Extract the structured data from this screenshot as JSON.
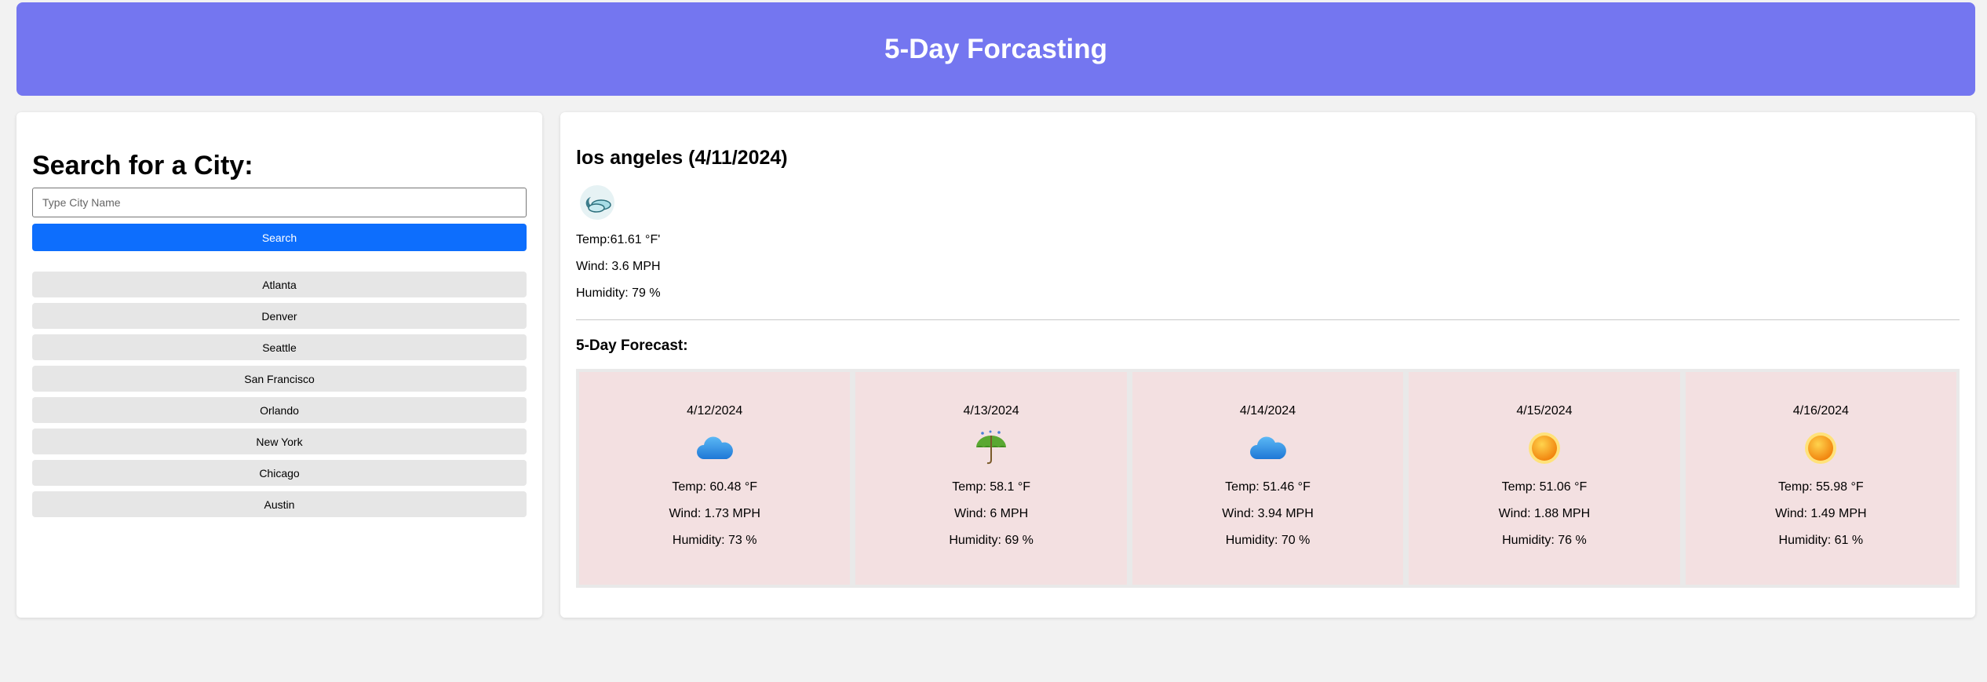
{
  "header": {
    "title": "5-Day Forcasting"
  },
  "search": {
    "heading": "Search for a City:",
    "placeholder": "Type City Name",
    "value": "",
    "button_label": "Search"
  },
  "history": [
    "Atlanta",
    "Denver",
    "Seattle",
    "San Francisco",
    "Orlando",
    "New York",
    "Chicago",
    "Austin"
  ],
  "current": {
    "title": "los angeles (4/11/2024)",
    "icon": "cloudy-night-icon",
    "temp": "Temp:61.61 °F'",
    "wind": "Wind: 3.6 MPH",
    "humidity": "Humidity: 79 %"
  },
  "forecast": {
    "heading": "5-Day Forecast:",
    "days": [
      {
        "date": "4/12/2024",
        "icon": "cloud-icon",
        "temp": "Temp: 60.48 °F",
        "wind": "Wind: 1.73 MPH",
        "humidity": "Humidity: 73 %"
      },
      {
        "date": "4/13/2024",
        "icon": "umbrella-rain-icon",
        "temp": "Temp: 58.1 °F",
        "wind": "Wind: 6 MPH",
        "humidity": "Humidity: 69 %"
      },
      {
        "date": "4/14/2024",
        "icon": "cloud-icon",
        "temp": "Temp: 51.46 °F",
        "wind": "Wind: 3.94 MPH",
        "humidity": "Humidity: 70 %"
      },
      {
        "date": "4/15/2024",
        "icon": "sun-icon",
        "temp": "Temp: 51.06 °F",
        "wind": "Wind: 1.88 MPH",
        "humidity": "Humidity: 76 %"
      },
      {
        "date": "4/16/2024",
        "icon": "sun-icon",
        "temp": "Temp: 55.98 °F",
        "wind": "Wind: 1.49 MPH",
        "humidity": "Humidity: 61 %"
      }
    ]
  },
  "colors": {
    "header": "#7476f0",
    "search_button": "#0d6efd",
    "city_button": "#e6e6e6",
    "forecast_card": "#f3e0e1"
  }
}
